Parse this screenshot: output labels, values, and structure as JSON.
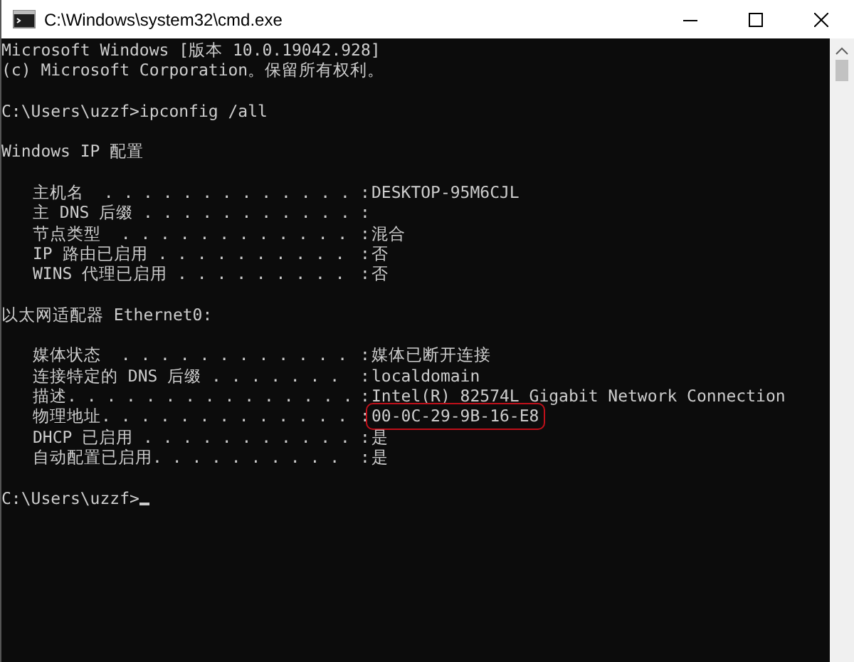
{
  "window": {
    "title": "C:\\Windows\\system32\\cmd.exe"
  },
  "console": [
    {
      "kind": "text",
      "text": "Microsoft Windows [版本 10.0.19042.928]"
    },
    {
      "kind": "text",
      "text": "(c) Microsoft Corporation。保留所有权利。"
    },
    {
      "kind": "blank"
    },
    {
      "kind": "text",
      "text": "C:\\Users\\uzzf>ipconfig /all"
    },
    {
      "kind": "blank"
    },
    {
      "kind": "text",
      "text": "Windows IP 配置"
    },
    {
      "kind": "blank"
    },
    {
      "kind": "entry",
      "label": "主机名  . . . . . . . . . . . . .",
      "separator": ":",
      "value": "DESKTOP-95M6CJL"
    },
    {
      "kind": "entry",
      "label": "主 DNS 后缀 . . . . . . . . . . .",
      "separator": ":"
    },
    {
      "kind": "entry",
      "label": "节点类型  . . . . . . . . . . . .",
      "separator": ":",
      "value": "混合"
    },
    {
      "kind": "entry",
      "label": "IP 路由已启用 . . . . . . . . . .",
      "separator": ":",
      "value": "否"
    },
    {
      "kind": "entry",
      "label": "WINS 代理已启用 . . . . . . . . .",
      "separator": ":",
      "value": "否"
    },
    {
      "kind": "blank"
    },
    {
      "kind": "text",
      "text": "以太网适配器 Ethernet0:"
    },
    {
      "kind": "blank"
    },
    {
      "kind": "entry",
      "label": "媒体状态  . . . . . . . . . . . .",
      "separator": ":",
      "value": "媒体已断开连接"
    },
    {
      "kind": "entry",
      "label": "连接特定的 DNS 后缀 . . . . . . .",
      "separator": ":",
      "value": "localdomain"
    },
    {
      "kind": "entry",
      "label": "描述. . . . . . . . . . . . . . .",
      "separator": ":",
      "value": "Intel(R) 82574L Gigabit Network Connection"
    },
    {
      "kind": "entry",
      "label": "物理地址. . . . . . . . . . . . .",
      "separator": ":",
      "value": "00-0C-29-9B-16-E8",
      "highlighted": true
    },
    {
      "kind": "entry",
      "label": "DHCP 已启用 . . . . . . . . . . .",
      "separator": ":",
      "value": "是"
    },
    {
      "kind": "entry",
      "label": "自动配置已启用. . . . . . . . . .",
      "separator": ":",
      "value": "是"
    },
    {
      "kind": "blank"
    },
    {
      "kind": "prompt",
      "text": "C:\\Users\\uzzf>",
      "cursor": true
    }
  ]
}
